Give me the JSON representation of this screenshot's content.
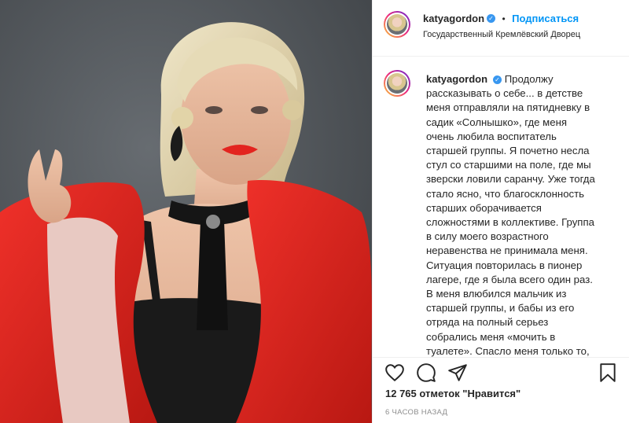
{
  "post": {
    "author": "katyagordon",
    "follow_label": "Подписаться",
    "separator": "•",
    "location": "Государственный Кремлёвский Дворец",
    "caption_author": "katyagordon",
    "caption_text": "Продолжу рассказывать о себе... в детстве меня отправляли на пятидневку в садик «Солнышко», где меня очень любила воспитатель старшей группы. Я почетно несла стул со старшими на поле, где мы зверски ловили саранчу. Уже тогда стало ясно, что благосклонность старших оборачивается сложностями в коллективе. Группа в силу моего возрастного неравенства не принимала меня. Ситуация повторилась в пионер лагере, где я была всего один раз. В меня влюбился мальчик из старшей группы, и бабы из его отряда на полный серьез собрались меня «мочить в туалете». Спасло меня только то, что в день расправы я",
    "likes": "12 765 отметок \"Нравится\"",
    "time_ago": "6 ЧАСОВ НАЗАД"
  },
  "icons": {
    "verified": "verified-badge-icon",
    "like": "heart-icon",
    "comment": "comment-icon",
    "share": "paper-plane-icon",
    "save": "bookmark-icon"
  },
  "colors": {
    "accent": "#0095f6",
    "jacket": "#e0241f",
    "background": "#4e5358"
  }
}
